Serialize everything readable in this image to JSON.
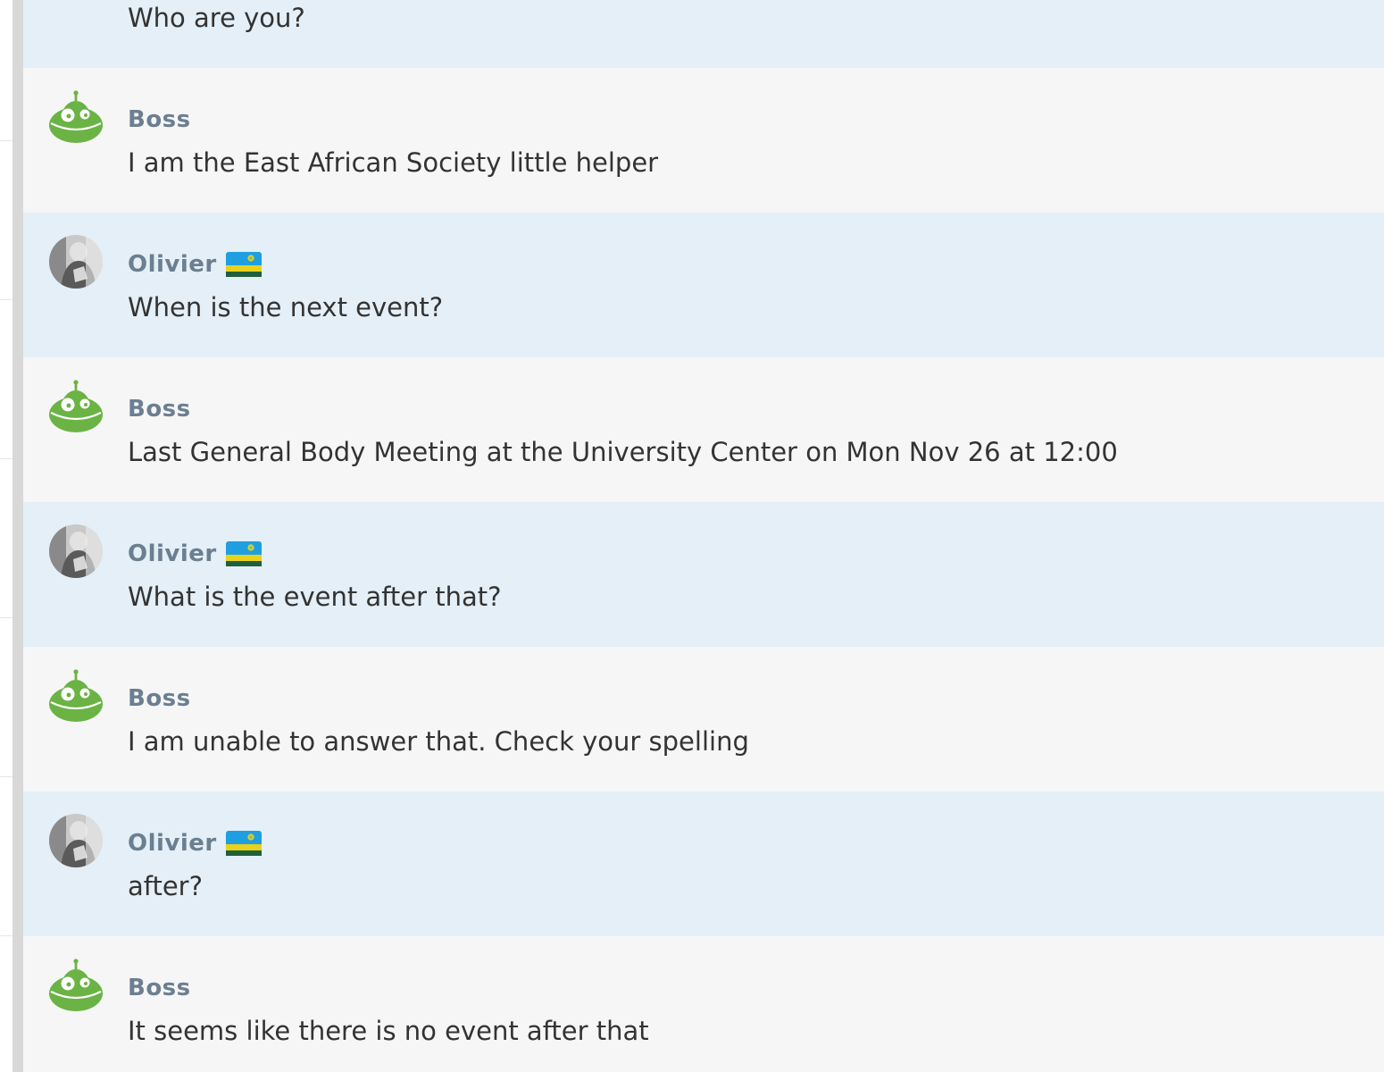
{
  "users": {
    "bot": {
      "name": "Boss"
    },
    "human": {
      "name": "Olivier",
      "flag": "rwanda-flag"
    }
  },
  "colors": {
    "user_row_bg": "#e4eff7",
    "bot_row_bg": "#f6f6f6",
    "sender_name": "#6b7f91",
    "message_text": "#333333",
    "bot_avatar_green": "#6ab344"
  },
  "messages": [
    {
      "role": "user",
      "text": "Who are you?"
    },
    {
      "role": "bot",
      "sender": "Boss",
      "text": "I am the East African Society little helper"
    },
    {
      "role": "user",
      "sender": "Olivier",
      "text": "When is the next event?"
    },
    {
      "role": "bot",
      "sender": "Boss",
      "text": "Last General Body Meeting at the University Center on Mon Nov 26 at 12:00"
    },
    {
      "role": "user",
      "sender": "Olivier",
      "text": "What is the event after that?"
    },
    {
      "role": "bot",
      "sender": "Boss",
      "text": "I am unable to answer that. Check your spelling"
    },
    {
      "role": "user",
      "sender": "Olivier",
      "text": "after?"
    },
    {
      "role": "bot",
      "sender": "Boss",
      "text": "It seems like there is no event after that"
    }
  ]
}
